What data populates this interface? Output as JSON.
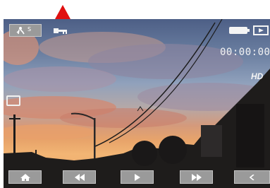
{
  "overlay": {
    "timecode": "00:00:00",
    "resolution_badge": "HD",
    "top_left_button_superscript": "S"
  },
  "icons": {
    "pointer": "red-up-arrow",
    "top_left": "mode-icon",
    "key": "key-icon",
    "battery": "battery-icon",
    "mode": "play-box-icon",
    "left": "image-frame-icon"
  },
  "toolbar": {
    "items": [
      "home-icon",
      "rewind-icon",
      "play-icon",
      "fast-forward-icon",
      "back-icon"
    ]
  },
  "colors": {
    "pointer": "#e01010",
    "button_fill": "#9a9a9a",
    "overlay_text": "#f4f4f4"
  }
}
